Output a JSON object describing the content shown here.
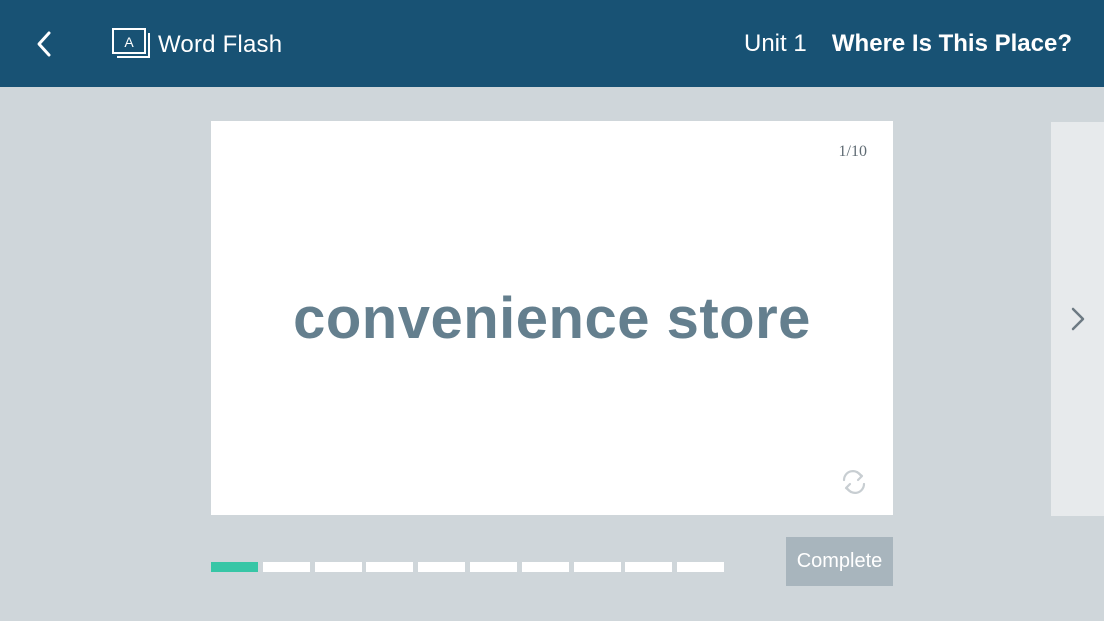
{
  "header": {
    "app_title": "Word Flash",
    "unit_label": "Unit 1",
    "lesson_title": "Where Is This Place?",
    "logo_letter": "A"
  },
  "card": {
    "counter": "1/10",
    "word": "convenience store"
  },
  "progress": {
    "current": 1,
    "total": 10
  },
  "actions": {
    "complete_label": "Complete"
  },
  "icons": {
    "back": "chevron-left-icon",
    "logo": "flashcard-icon",
    "flip": "flip-icon",
    "next": "chevron-right-icon"
  },
  "colors": {
    "header_bg": "#185274",
    "page_bg": "#cfd6da",
    "word_text": "#647f8e",
    "progress_active": "#37c6a6",
    "button_bg": "#a8b5bd"
  }
}
